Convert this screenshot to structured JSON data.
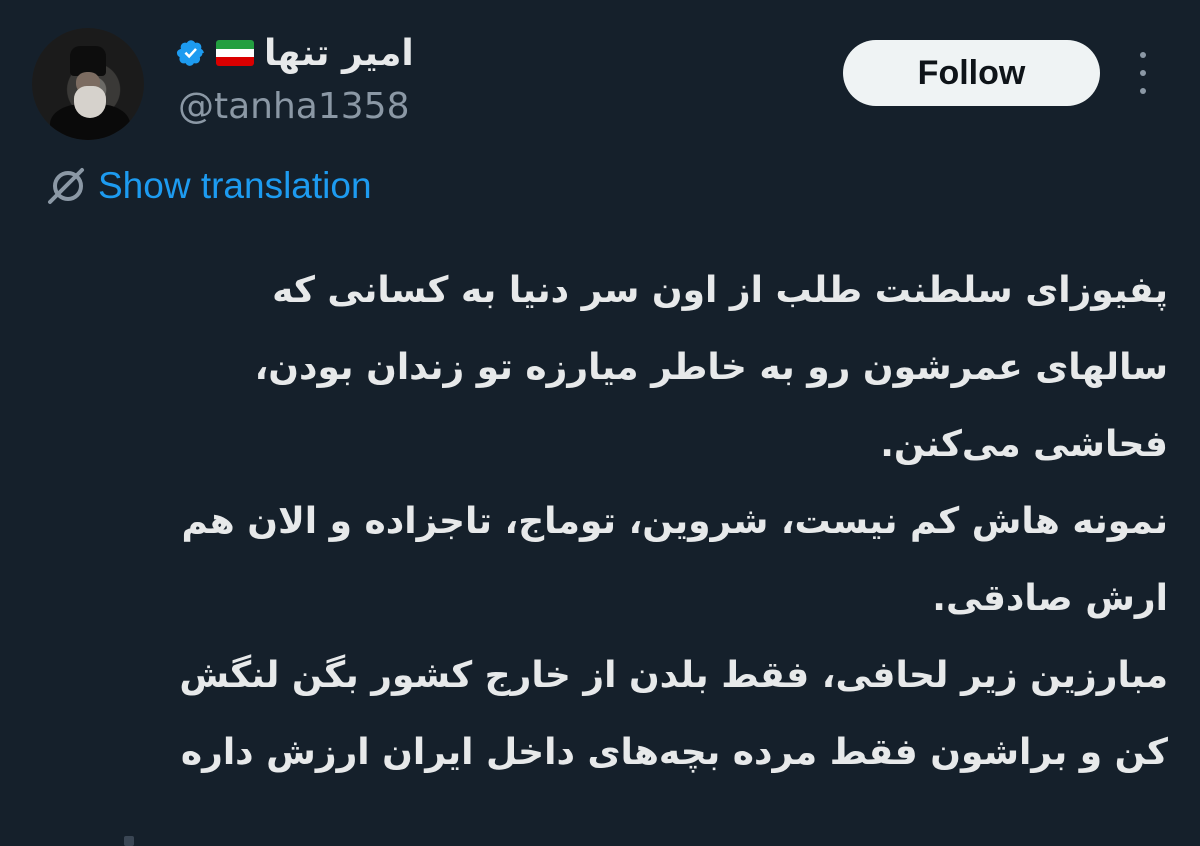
{
  "tweet": {
    "author": {
      "display_name": "امیر تنها",
      "handle": "@tanha1358",
      "verified": true,
      "flag_icon": "iran-flag-icon"
    },
    "follow_label": "Follow",
    "show_translation_label": "Show translation",
    "text_lines": [
      "پفیوزای سلطنت طلب از اون سر دنیا به کسانی که",
      "سالهای عمرشون رو به خاطر میارزه تو زندان بودن،",
      "فحاشی می‌کنن.",
      "نمونه هاش کم نیست، شروین، توماج، تاجزاده و الان هم",
      "ارش صادقی.",
      "مبارزین زیر لحافی، فقط بلدن از خارج کشور بگن لنگش",
      "کن و براشون فقط مرده بچه‌های داخل ایران ارزش داره"
    ]
  },
  "colors": {
    "background": "#15202b",
    "text": "#e7e9ea",
    "secondary_text": "#8b98a5",
    "link": "#1d9bf0",
    "follow_bg": "#eff3f4"
  }
}
